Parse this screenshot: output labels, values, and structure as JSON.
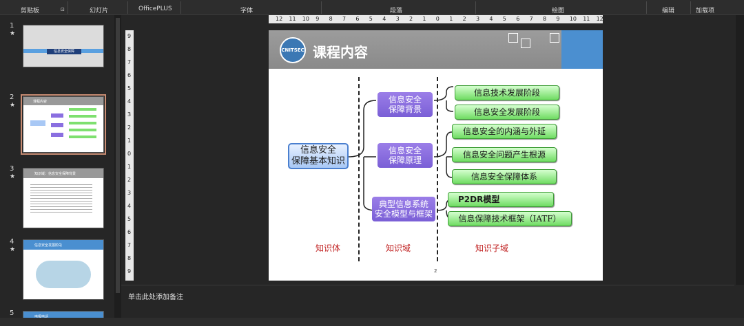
{
  "ribbon": {
    "groups": [
      "剪贴板",
      "幻灯片",
      "OfficePLUS",
      "字体",
      "段落",
      "绘图",
      "编辑",
      "加载项"
    ]
  },
  "thumbnails": [
    {
      "number": "1",
      "star": "★",
      "title": "信息安全保障"
    },
    {
      "number": "2",
      "star": "★",
      "title": "课程内容"
    },
    {
      "number": "3",
      "star": "★",
      "title": "知识域：信息安全保障背景"
    },
    {
      "number": "4",
      "star": "★",
      "title": "信息安全发展阶段"
    },
    {
      "number": "5",
      "star": "★",
      "title": "电报电话"
    }
  ],
  "hruler_labels": [
    "12",
    "11",
    "10",
    "9",
    "8",
    "7",
    "6",
    "5",
    "4",
    "3",
    "2",
    "1",
    "0",
    "1",
    "2",
    "3",
    "4",
    "5",
    "6",
    "7",
    "8",
    "9",
    "10",
    "11",
    "12"
  ],
  "vruler_labels": [
    "9",
    "8",
    "7",
    "6",
    "5",
    "4",
    "3",
    "2",
    "1",
    "0",
    "1",
    "2",
    "3",
    "4",
    "5",
    "6",
    "7",
    "8",
    "9"
  ],
  "slide": {
    "logo_text": "CNITSEC",
    "title": "课程内容",
    "root": {
      "line1": "信息安全",
      "line2": "保障基本知识"
    },
    "domains": [
      {
        "line1": "信息安全",
        "line2": "保障背景"
      },
      {
        "line1": "信息安全",
        "line2": "保障原理"
      },
      {
        "line1": "典型信息系统",
        "line2": "安全模型与框架"
      }
    ],
    "subdomains": [
      "信息技术发展阶段",
      "信息安全发展阶段",
      "信息安全的内涵与外延",
      "信息安全问题产生根源",
      "信息安全保障体系",
      "P2DR模型",
      "信息保障技术框架（IATF）"
    ],
    "categories": [
      "知识体",
      "知识域",
      "知识子域"
    ],
    "page_number": "2"
  },
  "notes": {
    "placeholder": "单击此处添加备注"
  }
}
